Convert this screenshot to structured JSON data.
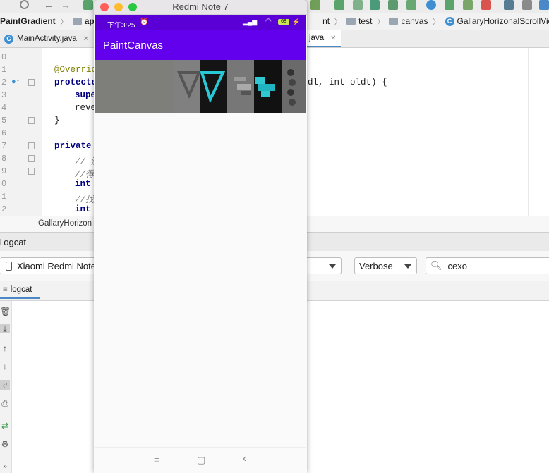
{
  "nav": {
    "project": "PaintGradient",
    "module": "app",
    "path_tail": [
      "nt",
      "test",
      "canvas"
    ],
    "class_name": "GallaryHorizonalScrollView"
  },
  "tabs": [
    {
      "label": "MainActivity.java"
    },
    {
      "label": "java"
    }
  ],
  "editor": {
    "line_numbers": [
      "0",
      "1",
      "2",
      "3",
      "4",
      "5",
      "6",
      "7",
      "8",
      "9",
      "0",
      "1",
      "2"
    ],
    "code_lines": [
      {
        "kind": "blank",
        "text": ""
      },
      {
        "kind": "ann",
        "text": "@Overrid"
      },
      {
        "kind": "kw",
        "text": "protecte",
        "tail": "dl, int oldt) {"
      },
      {
        "kind": "kw",
        "text": "supe"
      },
      {
        "kind": "plain",
        "text": "reve"
      },
      {
        "kind": "plain",
        "text": "}"
      },
      {
        "kind": "blank",
        "text": ""
      },
      {
        "kind": "kw",
        "text": "private"
      },
      {
        "kind": "cm",
        "text": "// 滴"
      },
      {
        "kind": "cm",
        "text": "//得到"
      },
      {
        "kind": "kw",
        "text": "int"
      },
      {
        "kind": "cm",
        "text": "//找到"
      },
      {
        "kind": "kw",
        "text": "int"
      }
    ],
    "breadcrumb": "GallaryHorizon",
    "tail_kw": "int",
    "tail_text": "oldt) {"
  },
  "logcat": {
    "title": "Logcat",
    "device": "Xiaomi Redmi Note",
    "level": "Verbose",
    "search_value": "cexo",
    "tab_label": "logcat"
  },
  "emulator": {
    "window_title": "Redmi Note 7",
    "status_time": "下午3:25",
    "battery": "68",
    "app_title": "PaintCanvas",
    "nav_menu": "≡",
    "nav_home": "▢",
    "nav_back": "‹"
  },
  "colors": {
    "app_bar": "#6200ee",
    "status_bar": "#5a00d6",
    "accent_tab": "#4a88c7"
  }
}
